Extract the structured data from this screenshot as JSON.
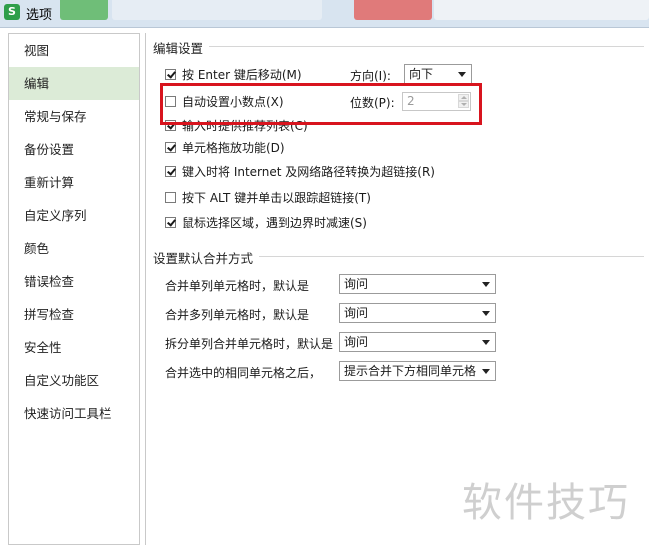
{
  "window": {
    "title": "选项",
    "app_icon": "S"
  },
  "sidebar": {
    "items": [
      {
        "label": "视图",
        "active": false
      },
      {
        "label": "编辑",
        "active": true
      },
      {
        "label": "常规与保存",
        "active": false
      },
      {
        "label": "备份设置",
        "active": false
      },
      {
        "label": "重新计算",
        "active": false
      },
      {
        "label": "自定义序列",
        "active": false
      },
      {
        "label": "颜色",
        "active": false
      },
      {
        "label": "错误检查",
        "active": false
      },
      {
        "label": "拼写检查",
        "active": false
      },
      {
        "label": "安全性",
        "active": false
      },
      {
        "label": "自定义功能区",
        "active": false
      },
      {
        "label": "快速访问工具栏",
        "active": false
      }
    ]
  },
  "edit_settings": {
    "title": "编辑设置",
    "move_after_enter": {
      "label": "按 Enter 键后移动(M)",
      "checked": true
    },
    "direction_label": "方向(I):",
    "direction_value": "向下",
    "auto_decimal": {
      "label": "自动设置小数点(X)",
      "checked": false
    },
    "places_label": "位数(P):",
    "places_value": "2",
    "autocomplete": {
      "label": "输入时提供推荐列表(C)",
      "checked": true
    },
    "drag_drop": {
      "label": "单元格拖放功能(D)",
      "checked": true
    },
    "auto_hyperlink": {
      "label": "键入时将 Internet 及网络路径转换为超链接(R)",
      "checked": true
    },
    "alt_click_hyperlink": {
      "label": "按下 ALT 键并单击以跟踪超链接(T)",
      "checked": false
    },
    "mouse_slowdown": {
      "label": "鼠标选择区域，遇到边界时减速(S)",
      "checked": true
    }
  },
  "merge_settings": {
    "title": "设置默认合并方式",
    "rows": [
      {
        "label": "合并单列单元格时，默认是",
        "value": "询问"
      },
      {
        "label": "合并多列单元格时，默认是",
        "value": "询问"
      },
      {
        "label": "拆分单列合并单元格时，默认是",
        "value": "询问"
      },
      {
        "label": "合并选中的相同单元格之后，",
        "value": "提示合并下方相同单元格"
      }
    ]
  },
  "watermark": "软件技巧",
  "colors": {
    "highlight": "#d8141e",
    "active_nav": "#dcebd7",
    "app_icon": "#2e9e4a"
  }
}
